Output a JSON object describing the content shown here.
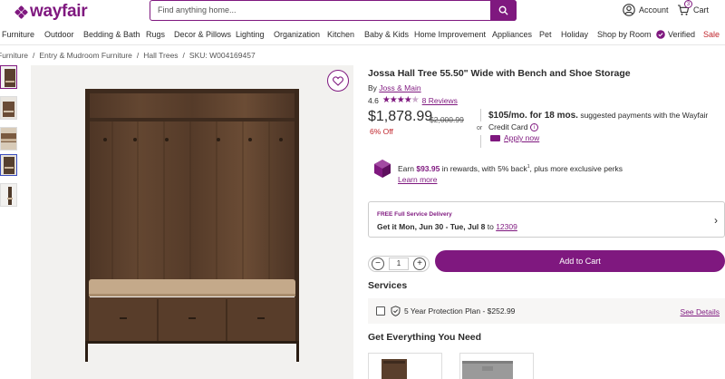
{
  "header": {
    "logo": "wayfair",
    "search_placeholder": "Find anything home...",
    "account_label": "Account",
    "cart_label": "Cart",
    "cart_count": "3"
  },
  "nav": {
    "items": [
      "Furniture",
      "Outdoor",
      "Bedding & Bath",
      "Rugs",
      "Decor & Pillows",
      "Lighting",
      "Organization",
      "Kitchen",
      "Baby & Kids",
      "Home Improvement",
      "Appliances",
      "Pet",
      "Holiday",
      "Shop by Room",
      "Verified",
      "Sale"
    ]
  },
  "breadcrumb": [
    "Furniture",
    "Entry & Mudroom Furniture",
    "Hall Trees",
    "SKU: W004169457"
  ],
  "product": {
    "title": "Jossa Hall Tree 55.50\" Wide with Bench and Shoe Storage",
    "by_label": "By",
    "brand": "Joss & Main",
    "rating": "4.6",
    "stars_filled": 4.6,
    "reviews": "8 Reviews",
    "price": "$1,878.99",
    "was_price": "$2,000.99",
    "discount": "6% Off",
    "or": "or",
    "monthly_amount": "$105/mo. for 18 mos.",
    "monthly_text": "suggested payments with the Wayfair Credit Card",
    "apply_now": "Apply now"
  },
  "rewards": {
    "prefix": "Earn",
    "amount": "$93.95",
    "suffix": "in rewards, with 5% back",
    "sup": "1",
    "suffix2": ", plus more exclusive perks",
    "learn_more": "Learn more"
  },
  "delivery": {
    "badge": "FREE Full Service Delivery",
    "text_prefix": "Get it",
    "dates": "Mon, Jun 30 - Tue, Jul 8",
    "to": "to",
    "zip": "12309"
  },
  "purchase": {
    "qty_minus": "−",
    "qty_value": "1",
    "qty_plus": "+",
    "add_to_cart": "Add to Cart"
  },
  "services": {
    "heading": "Services",
    "protection_plan": "5 Year Protection Plan - $252.99",
    "see_details": "See Details"
  },
  "everything": {
    "heading": "Get Everything You Need"
  },
  "colors": {
    "brand": "#7f187f",
    "discount": "#c0262d",
    "active_thumb": "#3a4dbf"
  }
}
